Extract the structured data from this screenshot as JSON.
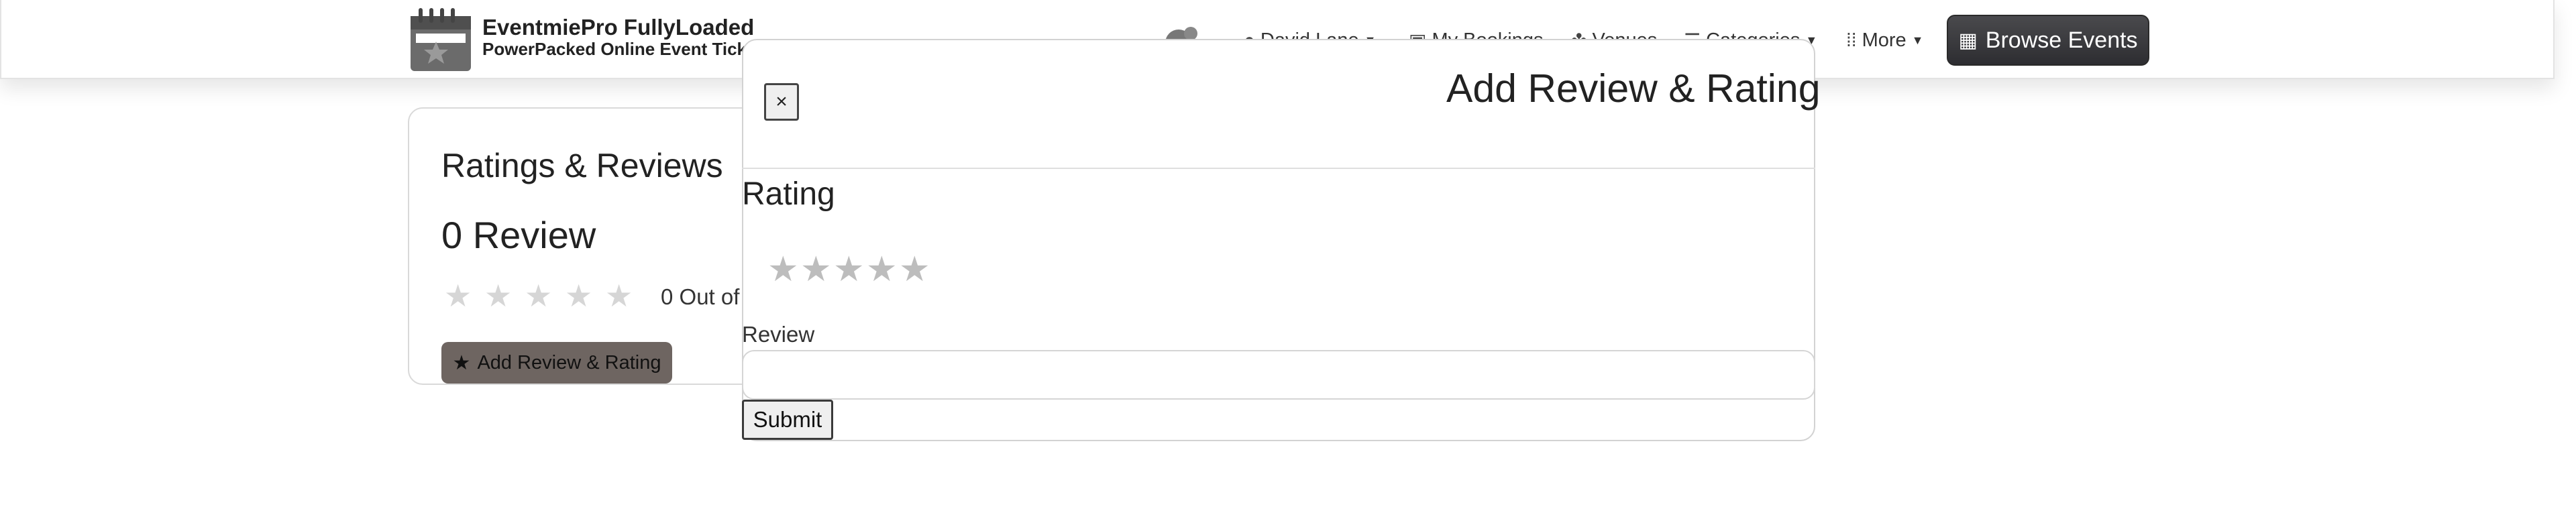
{
  "navbar": {
    "brand_title": "EventmiePro FullyLoaded",
    "brand_subtitle": "PowerPacked Online Event Ticke",
    "user_name": "David Lane",
    "my_bookings": "My Bookings",
    "venues": "Venues",
    "categories": "Categories",
    "more": "More",
    "browse_events": "Browse Events"
  },
  "card": {
    "title": "Ratings & Reviews",
    "review_count": "0 Review",
    "out_of": "0 Out of",
    "add_button": "Add Review & Rating",
    "rating_value": 0,
    "max_rating": 5
  },
  "modal": {
    "title": "Add Review & Rating",
    "close_label": "×",
    "rating_label": "Rating",
    "rating_value": 0,
    "max_rating": 5,
    "review_label": "Review",
    "review_value": "",
    "submit_label": "Submit"
  },
  "colors": {
    "browse_button": "#2d2d31",
    "add_button": "#6e6561",
    "star_empty": "#bdbdbd"
  }
}
